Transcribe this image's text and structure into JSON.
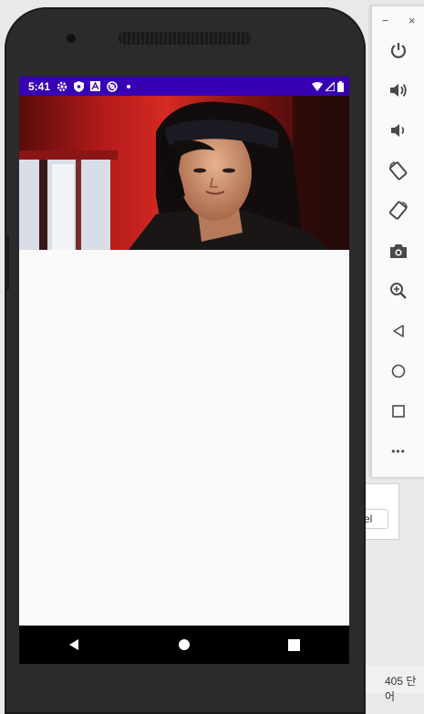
{
  "status_bar": {
    "time": "5:41"
  },
  "emulator": {
    "minimize_label": "−",
    "close_label": "×",
    "more_label": "•••"
  },
  "background": {
    "partial_button": "el",
    "partial_status": "405 단어"
  },
  "colors": {
    "status_bar": "#3700b3",
    "nav_bar": "#000000",
    "content_bg": "#fafafa",
    "phone_body": "#2b2b2b"
  }
}
